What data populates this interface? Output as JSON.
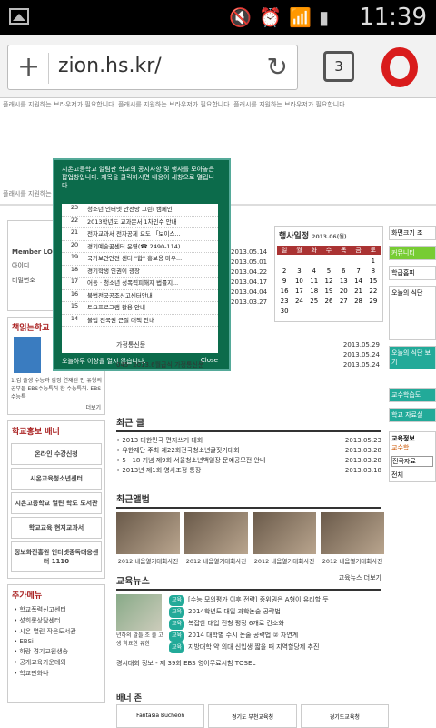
{
  "status": {
    "time": "11:39"
  },
  "browser": {
    "url": "zion.hs.kr/",
    "tab_count": "3"
  },
  "page_info": {
    "flash1": "플래시를 지원하는 브라우저가 필요합니다. 플래시를 지원하는 브라우저가 필요합니다. 플래시를 지원하는 브라우저가 필요합니다.",
    "flash2": "플래시를 지원하는 브라우저가 필요합니다."
  },
  "left": {
    "login_title": "Member LOG-IN",
    "id_label": "아이디",
    "pw_label": "비밀번호",
    "book_title": "책읽는학교",
    "book_desc": "1.김 출생 수능과 감정 연재된 인 유형의 공부들 EBS수능특허 한 수능특허. EBS수능특",
    "more": "더보기",
    "banner_title": "학교홍보 배너",
    "banner_more": "더보기",
    "banner_items": [
      "온라인 수강신청",
      "시온교육청소년센터",
      "시온고등학교 열린 학도 도서관",
      "학교교육 현지교과서",
      "정보화진흥원 인터넷중독대응센터 1110"
    ],
    "add_title": "추가메뉴",
    "add_items": [
      "학교폭력신고센터",
      "성희롱상담센터",
      "시온 열린 작은도서관",
      "EBSi",
      "하랑 경기교원생송",
      "공개교육가운데외",
      "학교만화나"
    ]
  },
  "popup": {
    "head": "시온고등학교 알림판 학교의 공지사항 및 행사를 모아놓은 팝업창입니다. 제목을 클릭하시면 내용이 새창으로 열립니다.",
    "items": [
      {
        "n": "23",
        "t": "청소년 인터넷 안전망 그린i 캠페인"
      },
      {
        "n": "22",
        "t": "2013학년도 교과문서 1차인수 안내"
      },
      {
        "n": "21",
        "t": "전자교과서 전자공제 요도 「보이스..."
      },
      {
        "n": "20",
        "t": "경기예술꿈센터 운영(☎ 2490-114)"
      },
      {
        "n": "19",
        "t": "국가보안안전 센터 \"합\" 홍보용 마우..."
      },
      {
        "n": "18",
        "t": "경기학생 인권이 광장"
      },
      {
        "n": "17",
        "t": "어동 · 청소년 성폭력피해자 법률지..."
      },
      {
        "n": "16",
        "t": "불법전국공조신고센터안내"
      },
      {
        "n": "15",
        "t": "토요프로그램 활용 안내"
      },
      {
        "n": "14",
        "t": "불법 전국권 근절 대책 안내"
      }
    ],
    "footer": "오늘하루 이창을 열지 않습니다.",
    "close": "Close"
  },
  "notice_dates": [
    "2013.05.14",
    "2013.05.01",
    "2013.04.22",
    "2013.04.17",
    "2013.04.04",
    "2013.03.27"
  ],
  "calendar": {
    "title": "행사일정",
    "month": "2013.06(월)",
    "days": [
      "일",
      "월",
      "화",
      "수",
      "목",
      "금",
      "토"
    ],
    "dates": [
      "",
      "",
      "",
      "",
      "",
      "",
      "1",
      "2",
      "3",
      "4",
      "5",
      "6",
      "7",
      "8",
      "9",
      "10",
      "11",
      "12",
      "13",
      "14",
      "15",
      "16",
      "17",
      "18",
      "19",
      "20",
      "21",
      "22",
      "23",
      "24",
      "25",
      "26",
      "27",
      "28",
      "29",
      "30",
      "",
      "",
      "",
      "",
      "",
      ""
    ]
  },
  "news_more": {
    "rows": [
      {
        "t": "가정통신문",
        "d": "2013.05.29"
      },
      {
        "t": "",
        "d": "2013.05.24"
      },
      {
        "t": "045- 2013.6월급식 가정통신문",
        "d": "2013.05.24"
      }
    ]
  },
  "latest": {
    "title": "최근 글",
    "rows": [
      {
        "t": "2013 대한민국 편지쓰기 대회",
        "d": "2013.05.23"
      },
      {
        "t": "유한재단 주최 제22회전국청소년글짓기대회",
        "d": "2013.03.28"
      },
      {
        "t": "5 · 18 기념 제9회 서울청소년백일장 문예공모전 안내",
        "d": "2013.03.28"
      },
      {
        "t": "2013년 제1회 영사조정 통장",
        "d": "2013.03.18"
      }
    ]
  },
  "album": {
    "title": "최근앨범",
    "items": [
      "2012 내음열기대회사진",
      "2012 내음열기대회사진",
      "2012 내음열기대회사진",
      "2012 내음열기대회사진"
    ]
  },
  "edu_news": {
    "title": "교육뉴스",
    "more": "교육뉴스 더보기",
    "caption": "년하의 말들 조 즐 고생 학요한 유한",
    "items": [
      {
        "tag": "교육",
        "t": "[수능 모의평가 이후 전략] 중위권은 A형이 유리할 듯"
      },
      {
        "tag": "교육",
        "t": "2014학년도 대입 과학논술 공략법"
      },
      {
        "tag": "교육",
        "t": "복잡한 대입 전형 평정 6개로 간소화"
      },
      {
        "tag": "교육",
        "t": "2014 대학별 수시 논술 공략법 ② 자연계"
      },
      {
        "tag": "교육",
        "t": "지방대학 약 의대 신입생 짧을 때 지역할당제 추진"
      }
    ],
    "exam": "경시대회 정보 -  제 39회 EBS 영어무료시험 TOSEL"
  },
  "banner_zone": {
    "title": "배너 존",
    "items": [
      "Fantasia Bucheon",
      "경기도 부천교육청",
      "경기도교육청"
    ]
  },
  "right": {
    "top": "화면크기 조",
    "career": "커뮤니티",
    "sched": "학급홈피",
    "diet": "오늘의 식단",
    "diet2": "오늘의 식단 보기",
    "cafe": "교수학습도",
    "school": "학교 자료실",
    "eduinfo": "교육정보",
    "search_tab": "교수학",
    "select": "전국자료",
    "radio": "전체"
  }
}
